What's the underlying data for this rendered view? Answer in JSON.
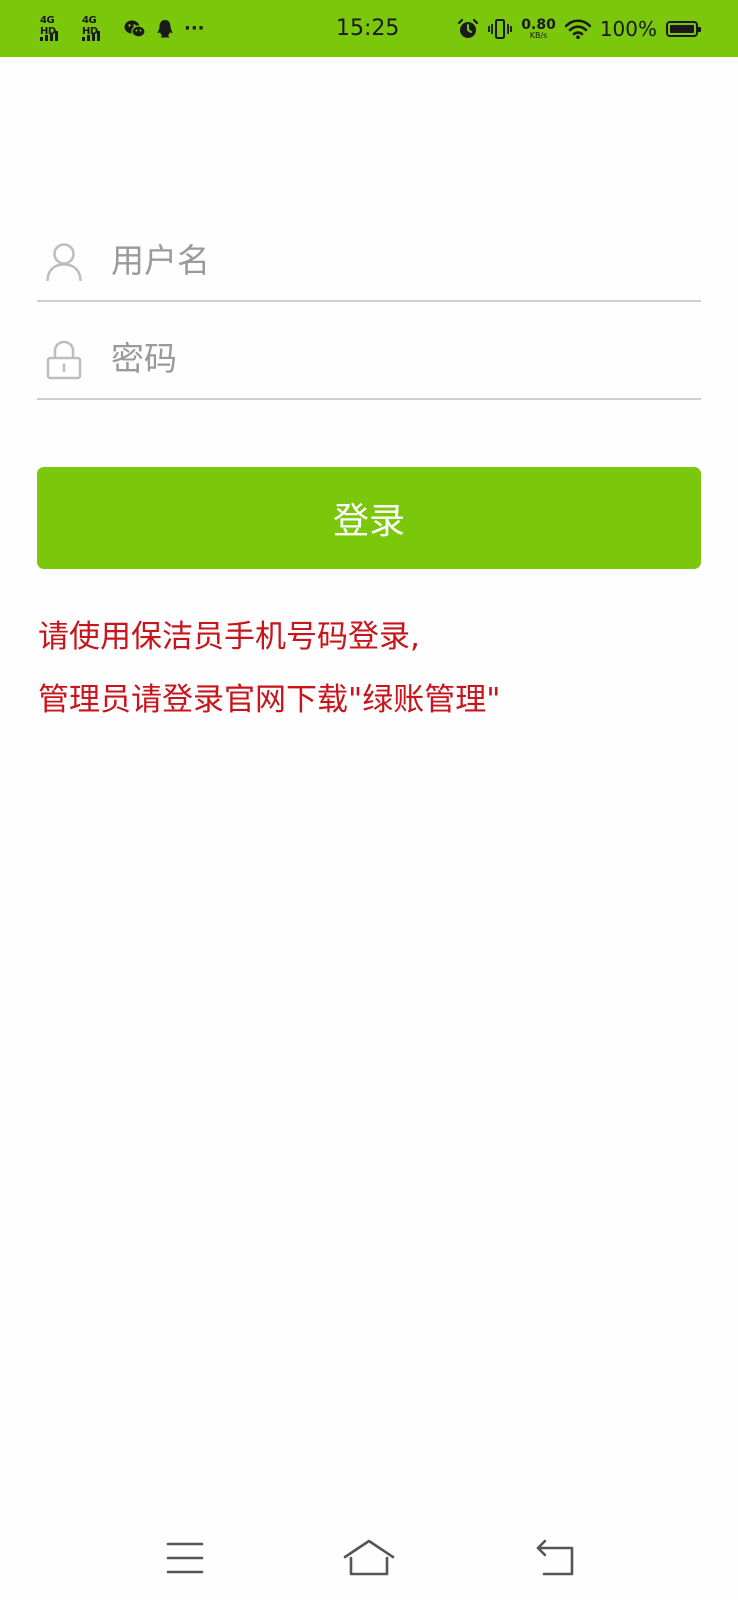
{
  "status_bar": {
    "signal_1_label": "4G HD",
    "signal_2_label": "4G HD",
    "more_label": "···",
    "time": "15:25",
    "net_speed_value": "0.80",
    "net_speed_unit": "KB/s",
    "battery_percent": "100%",
    "background_color": "#7ac70c"
  },
  "login_form": {
    "username_placeholder": "用户名",
    "password_placeholder": "密码",
    "username_icon": "user-icon",
    "password_icon": "lock-icon",
    "login_button_label": "登录",
    "button_color": "#7ac70c"
  },
  "notice": {
    "line1": "请使用保洁员手机号码登录,",
    "line2": "管理员请登录官网下载\"绿账管理\"",
    "color": "#c8151b"
  },
  "nav_bar": {
    "menu_icon": "menu-icon",
    "home_icon": "home-icon",
    "back_icon": "back-icon"
  }
}
